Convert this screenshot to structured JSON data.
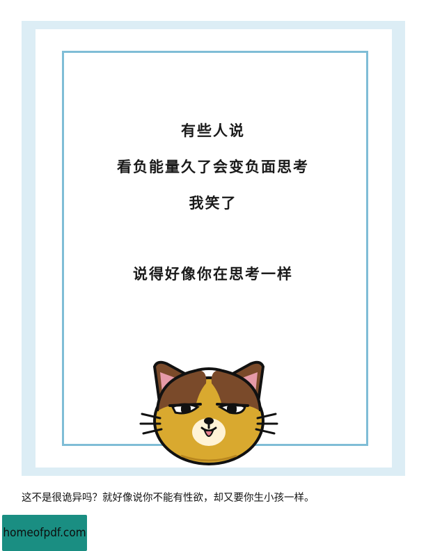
{
  "poster": {
    "lines": [
      "有些人说",
      "看负能量久了会变负面思考",
      "我笑了",
      "说得好像你在思考一样"
    ],
    "illustration_icon": "cat-face-icon",
    "colors": {
      "outer_border": "#dcedf5",
      "frame_border": "#7fbdd6",
      "text": "#1a1a1a"
    }
  },
  "caption": "这不是很诡异吗？就好像说你不能有性欲，却又要你生小孩一样。",
  "watermark": {
    "text": "homeofpdf.com",
    "background": "#1a8e82"
  }
}
